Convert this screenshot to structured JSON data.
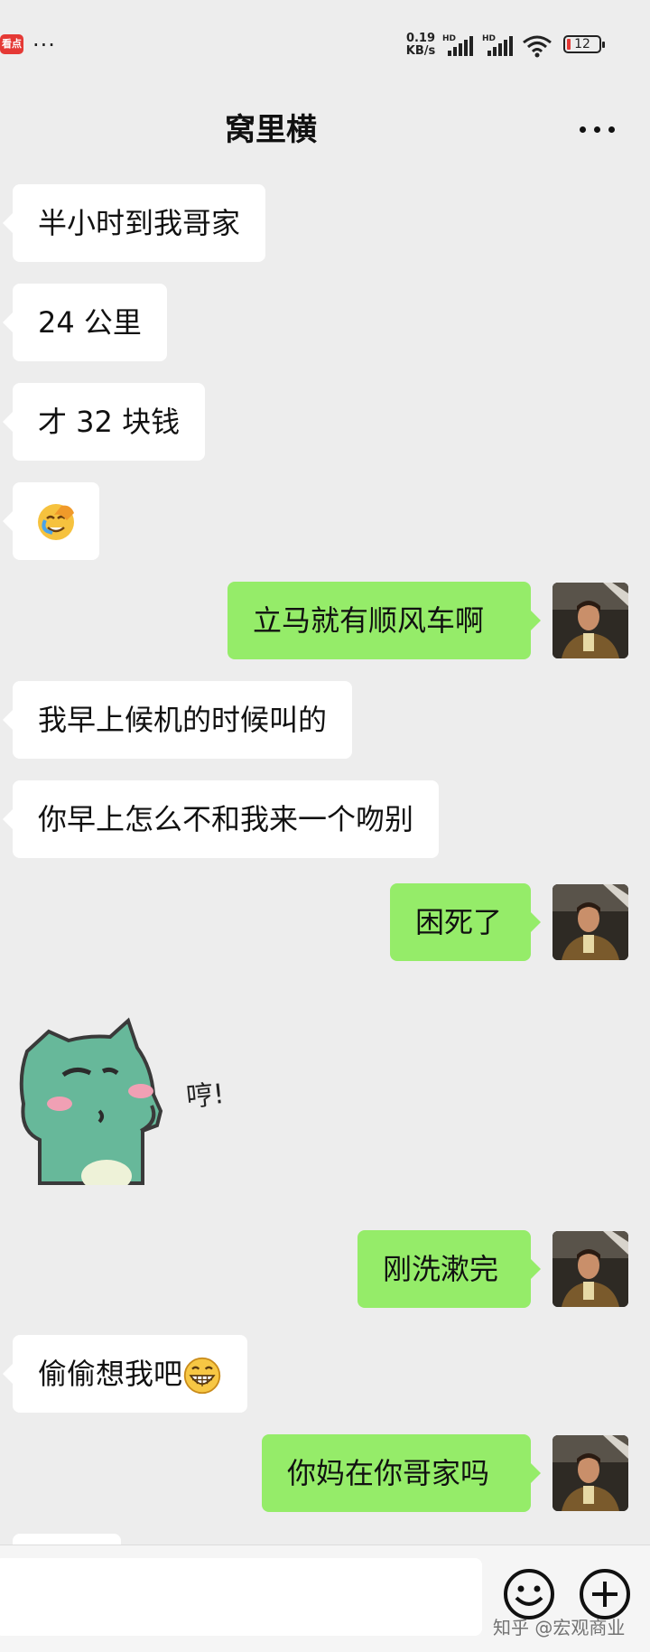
{
  "status_bar": {
    "app_badge": "看点",
    "overflow": "···",
    "speed_value": "0.19",
    "speed_unit": "KB/s",
    "signal_label": "HD",
    "battery": "12"
  },
  "header": {
    "title": "窝里横",
    "more_icon": "more-dots-icon"
  },
  "messages": [
    {
      "side": "in",
      "text": "半小时到我哥家"
    },
    {
      "side": "in",
      "text": "24 公里"
    },
    {
      "side": "in",
      "text": "才 32 块钱"
    },
    {
      "side": "in",
      "emoji": "face-with-hand-icon"
    },
    {
      "side": "out",
      "text": "立马就有顺风车啊"
    },
    {
      "side": "in",
      "text": "我早上候机的时候叫的"
    },
    {
      "side": "in",
      "text": "你早上怎么不和我来一个吻别"
    },
    {
      "side": "out",
      "text": "困死了"
    },
    {
      "side": "in",
      "sticker": "green-cat-sticker",
      "sticker_text": "哼!"
    },
    {
      "side": "out",
      "text": "刚洗漱完"
    },
    {
      "side": "in",
      "text": "偷偷想我吧",
      "emoji": "grin-emoji-icon"
    },
    {
      "side": "out",
      "text": "你妈在你哥家吗"
    }
  ],
  "input_bar": {
    "emoji_icon": "emoji-smile-icon",
    "plus_icon": "plus-circle-icon"
  },
  "watermark": "知乎 @宏观商业",
  "colors": {
    "background": "#ededed",
    "incoming_bubble": "#ffffff",
    "outgoing_bubble": "#95ec69"
  }
}
